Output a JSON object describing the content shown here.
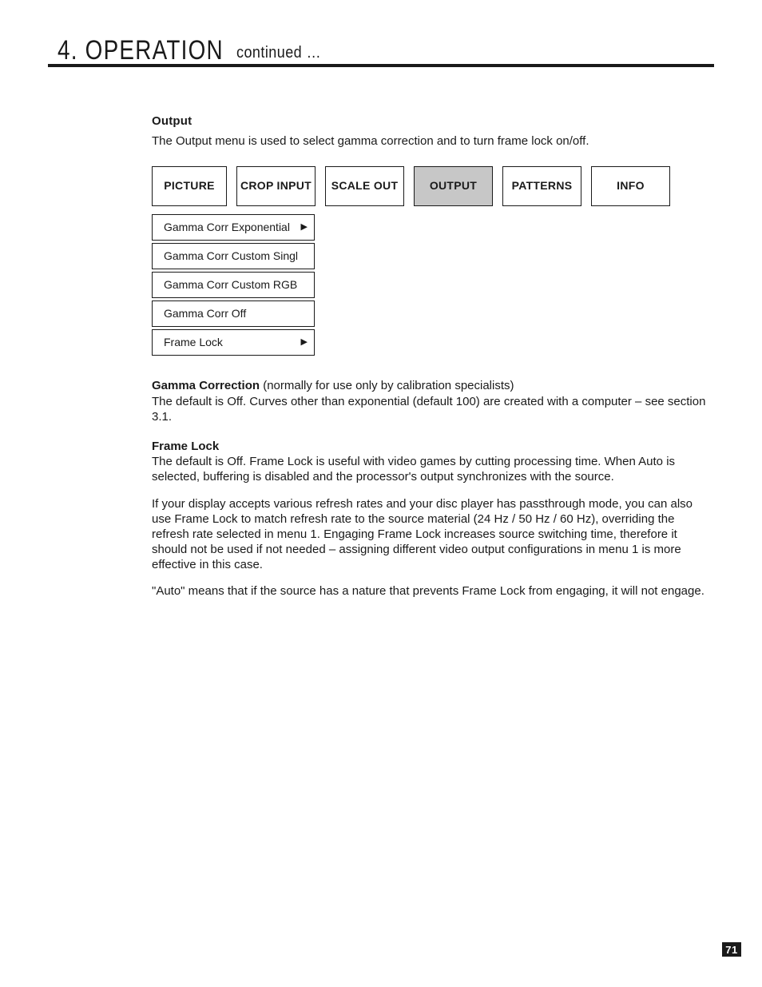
{
  "header": {
    "chapter": "4. OPERATION",
    "continued": "continued …"
  },
  "section": {
    "title": "Output",
    "intro": "The Output menu is used to select gamma correction and to turn frame lock on/off."
  },
  "tabs": {
    "picture": "PICTURE",
    "cropinput": "CROP INPUT",
    "scaleout": "SCALE OUT",
    "output": "OUTPUT",
    "patterns": "PATTERNS",
    "info": "INFO"
  },
  "menu": {
    "items": [
      {
        "label": "Gamma Corr Exponential",
        "arrow": "▶"
      },
      {
        "label": "Gamma Corr Custom Singl",
        "arrow": ""
      },
      {
        "label": "Gamma Corr Custom RGB",
        "arrow": ""
      },
      {
        "label": "Gamma Corr Off",
        "arrow": ""
      },
      {
        "label": "Frame Lock",
        "arrow": "▶"
      }
    ]
  },
  "body": {
    "gamma_bold": "Gamma Correction",
    "gamma_line1_rest": " (normally for use only by calibration specialists)",
    "gamma_line2": "The default is Off. Curves other than exponential (default 100) are created with a computer – see section 3.1.",
    "framelock_bold": "Frame Lock",
    "framelock_p1": "The default is Off. Frame Lock is useful with video games by cutting processing time. When Auto is selected, buffering is disabled and the processor's output synchronizes with the source.",
    "framelock_p2": "If your display accepts various refresh rates and your disc player has passthrough mode, you can also use Frame Lock to match refresh rate to the source material (24 Hz / 50 Hz / 60 Hz), overriding the refresh rate selected in menu 1. Engaging Frame Lock increases source switching time, therefore it should not be used if not needed – assigning different video output configurations in menu 1 is more effective in this case.",
    "framelock_p3": "\"Auto\" means that if the source has a nature that prevents Frame Lock from engaging, it will not engage."
  },
  "page_number": "71"
}
